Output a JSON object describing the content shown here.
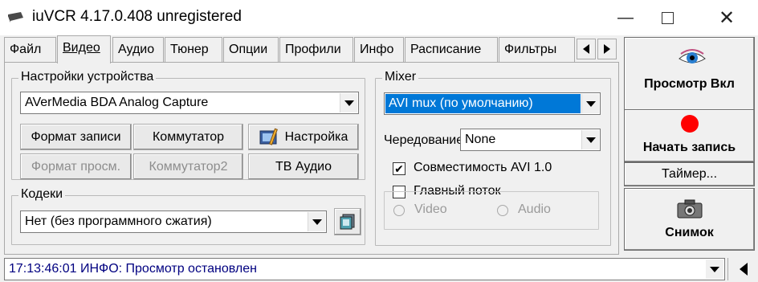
{
  "window": {
    "title": "iuVCR 4.17.0.408 unregistered",
    "minimize_glyph": "—",
    "close_glyph": "✕"
  },
  "tabs": [
    {
      "label": "Файл",
      "icon": ""
    },
    {
      "label": "Видео",
      "icon": ""
    },
    {
      "label": "Аудио",
      "icon": ""
    },
    {
      "label": "Тюнер",
      "icon": ""
    },
    {
      "label": "Опции",
      "icon": ""
    },
    {
      "label": "Профили",
      "icon": ""
    },
    {
      "label": "Инфо",
      "icon": ""
    },
    {
      "label": "Расписание",
      "icon": ""
    },
    {
      "label": "Фильтры",
      "icon": ""
    }
  ],
  "active_tab": "Видео",
  "device_settings": {
    "legend": "Настройки устройства",
    "device": "AVerMedia BDA Analog Capture",
    "buttons": {
      "record_format": "Формат записи",
      "switcher": "Коммутатор",
      "settings": "Настройка",
      "preview_format": "Формат просм.",
      "switcher2": "Коммутатор2",
      "tv_audio": "ТВ Аудио"
    }
  },
  "codecs": {
    "legend": "Кодеки",
    "value": "Нет (без программного сжатия)"
  },
  "mixer": {
    "legend": "Mixer",
    "value": "AVI mux (по умолчанию)",
    "interleave_label": "Чередование",
    "interleave_value": "None",
    "avi_compat": {
      "label": "Совместимость AVI 1.0",
      "checked": true,
      "mark": "✔"
    },
    "main_stream": {
      "label": "Главный поток",
      "checked": false
    },
    "radio_video": "Video",
    "radio_audio": "Audio"
  },
  "side": {
    "preview_button": "Просмотр Вкл",
    "record_button": "Начать запись",
    "timer_button": "Таймер...",
    "snapshot_button": "Снимок",
    "record_color": "#ff0000"
  },
  "status": {
    "text": "17:13:46:01 ИНФО: Просмотр остановлен"
  },
  "colors": {
    "selection": "#0078d7",
    "status_text": "#000080"
  }
}
